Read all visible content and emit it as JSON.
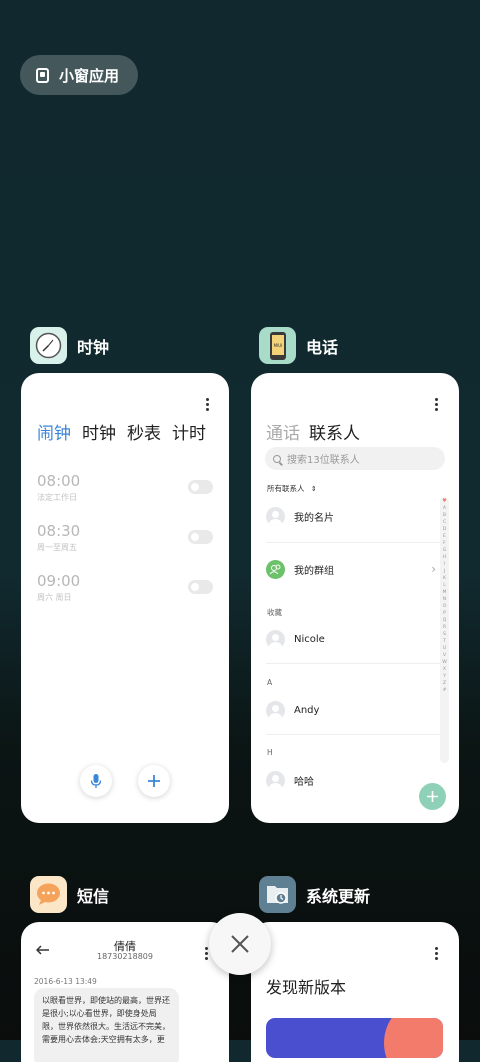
{
  "float_pill": {
    "label": "小窗应用",
    "icon": "small-window-icon"
  },
  "apps": {
    "clock": {
      "name": "时钟",
      "icon": "clock-icon",
      "tabs": [
        "闹钟",
        "时钟",
        "秒表",
        "计时"
      ],
      "active_tab": "闹钟",
      "alarms": [
        {
          "time": "08:00",
          "repeat": "法定工作日",
          "enabled": false
        },
        {
          "time": "08:30",
          "repeat": "周一至周五",
          "enabled": false
        },
        {
          "time": "09:00",
          "repeat": "周六 周日",
          "enabled": false
        }
      ]
    },
    "phone": {
      "name": "电话",
      "icon": "phone-icon",
      "icon_text": "MIUI",
      "tabs": [
        "通话",
        "联系人"
      ],
      "active_tab": "联系人",
      "search_placeholder": "搜索13位联系人",
      "all_contacts_label": "所有联系人",
      "my_card": "我的名片",
      "my_groups": "我的群组",
      "favorites_label": "收藏",
      "contacts": [
        {
          "section": "",
          "name": "Nicole"
        },
        {
          "section": "A",
          "name": "Andy"
        },
        {
          "section": "H",
          "name": "哈哈"
        }
      ],
      "index_letters": [
        "♥",
        "A",
        "B",
        "C",
        "D",
        "E",
        "F",
        "G",
        "H",
        "I",
        "J",
        "K",
        "L",
        "M",
        "N",
        "O",
        "P",
        "Q",
        "R",
        "S",
        "T",
        "U",
        "V",
        "W",
        "X",
        "Y",
        "Z",
        "#"
      ]
    },
    "sms": {
      "name": "短信",
      "icon": "sms-icon",
      "contact_name": "倩倩",
      "contact_number": "18730218809",
      "date": "2016-6-13 13:49",
      "message": "以眼看世界，即使站的最高，世界还是很小;以心看世界，即使身处局限，世界依然很大。生活远不完美，需要用心去体会;天空拥有太多，更"
    },
    "update": {
      "name": "系统更新",
      "icon": "system-update-icon",
      "headline": "发现新版本"
    }
  },
  "colors": {
    "accent_blue": "#3b86d6",
    "fab_green": "#8ed1b8",
    "group_green": "#6cc16a"
  }
}
